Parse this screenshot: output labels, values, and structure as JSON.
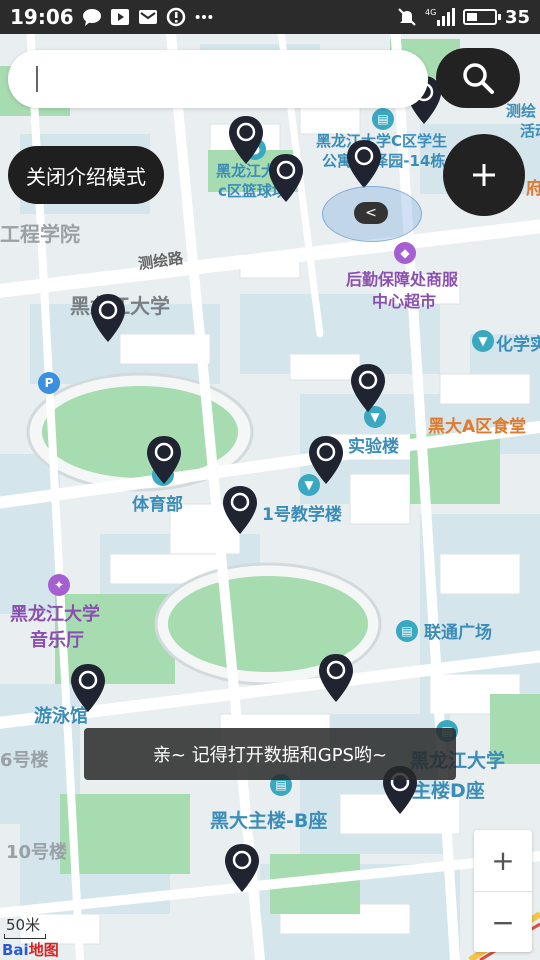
{
  "status_bar": {
    "time": "19:06",
    "battery": "35",
    "network": "4G",
    "icons": [
      "chat-icon",
      "play-icon",
      "mail-icon",
      "alert-icon",
      "more-icon",
      "mute-icon",
      "signal-icon",
      "battery-icon"
    ]
  },
  "search": {
    "placeholder": "",
    "value": ""
  },
  "buttons": {
    "intro_mode": "关闭介绍模式",
    "search_icon": "search-icon",
    "add_icon": "plus-icon"
  },
  "map": {
    "labels": {
      "school_engineering": "工程学院",
      "road_cehui": "测绘路",
      "univ_name": "黑龙江大学",
      "c_dorm": "黑龙江大学C区学生",
      "c_dorm2": "公寓-华泽园-14栋",
      "c_court1": "黑龙江大",
      "c_court2": "c区篮球场",
      "logistics1": "后勤保障处商服",
      "logistics2": "中心超市",
      "chemistry": "化学实",
      "a_canteen": "黑大A区食堂",
      "lab_building": "实验楼",
      "sports_dept": "体育部",
      "teaching1": "1号教学楼",
      "music_hall1": "黑龙江大学",
      "music_hall2": "音乐厅",
      "unicom": "联通广场",
      "swimming": "游泳馆",
      "building6": "6号楼",
      "building10": "10号楼",
      "main_b": "黑大主楼-B座",
      "main_d1": "黑龙江大学",
      "main_d2": "主楼D座",
      "cehui_top": "测绘",
      "huodong": "活动",
      "fu": "府",
      "parking": "P"
    },
    "scale_label": "50米",
    "logo_text": "Bai",
    "logo_text2": "地图"
  },
  "toast": {
    "message": "亲~ 记得打开数据和GPS哟~"
  },
  "zoom": {
    "in": "+",
    "out": "−"
  },
  "colors": {
    "dark_button": "#222222",
    "marker": "#1f2430",
    "map_water": "#cfe3ea",
    "map_green": "#9bd7a8"
  }
}
